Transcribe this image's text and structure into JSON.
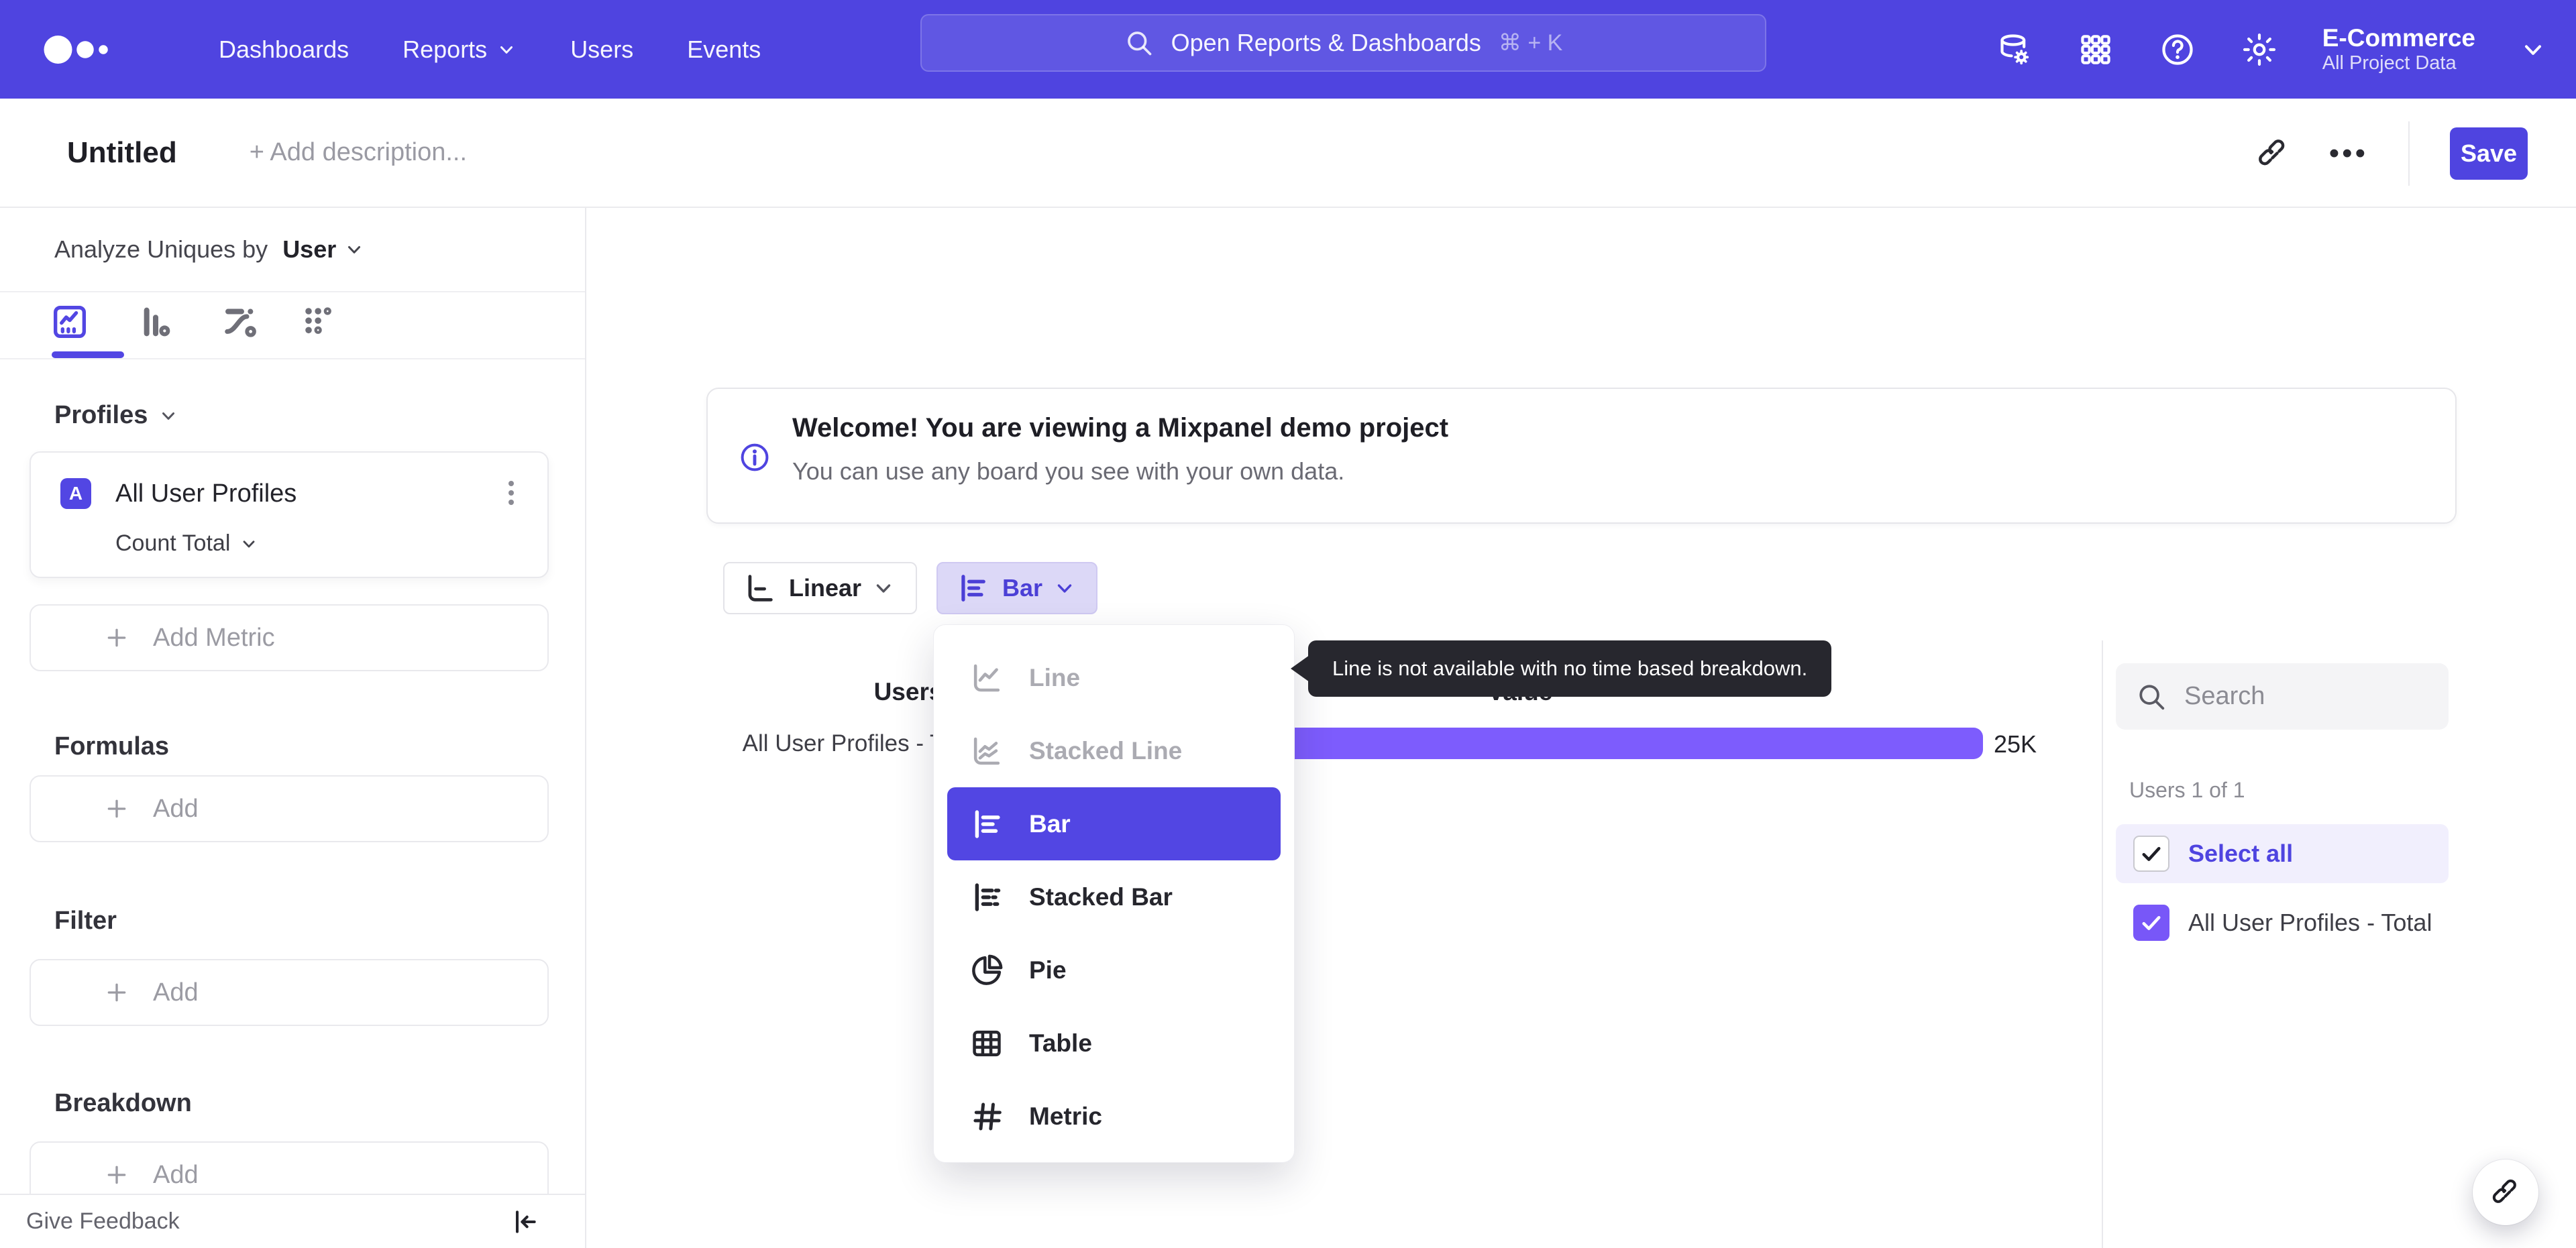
{
  "colors": {
    "brand_indigo": "#4f44e0",
    "menu_selected_bg": "#5246e3",
    "bar_fill": "#7d5cfd",
    "checkbox_fill": "#7857f8",
    "chip_bg": "#dcd8f7",
    "select_all_bg": "#f1effd",
    "tooltip_bg": "#27272e"
  },
  "topnav": {
    "items": [
      {
        "label": "Dashboards"
      },
      {
        "label": "Reports"
      },
      {
        "label": "Users"
      },
      {
        "label": "Events"
      }
    ],
    "search": {
      "placeholder": "Open Reports & Dashboards",
      "shortcut": "⌘ + K"
    },
    "project": {
      "name": "E-Commerce",
      "scope": "All Project Data"
    }
  },
  "header": {
    "title": "Untitled",
    "description_placeholder": "+ Add description...",
    "save_label": "Save"
  },
  "sidebar": {
    "analyze_label": "Analyze Uniques by",
    "analyze_value": "User",
    "profiles_label": "Profiles",
    "metric_card": {
      "badge": "A",
      "name": "All User Profiles",
      "aggregation": "Count Total"
    },
    "add_metric_label": "Add Metric",
    "sections": [
      {
        "title": "Formulas",
        "add_label": "Add"
      },
      {
        "title": "Filter",
        "add_label": "Add"
      },
      {
        "title": "Breakdown",
        "add_label": "Add"
      }
    ],
    "feedback_label": "Give Feedback"
  },
  "banner": {
    "title": "Welcome! You are viewing a Mixpanel demo project",
    "subtitle": "You can use any board you see with your own data."
  },
  "controls": {
    "scale_label": "Linear",
    "chart_type_label": "Bar"
  },
  "chart_menu": {
    "items": [
      {
        "label": "Line",
        "state": "disabled"
      },
      {
        "label": "Stacked Line",
        "state": "disabled"
      },
      {
        "label": "Bar",
        "state": "selected"
      },
      {
        "label": "Stacked Bar",
        "state": "normal"
      },
      {
        "label": "Pie",
        "state": "normal"
      },
      {
        "label": "Table",
        "state": "normal"
      },
      {
        "label": "Metric",
        "state": "normal"
      }
    ]
  },
  "tooltip": {
    "text": "Line is not available with no time based breakdown."
  },
  "chart_data": {
    "type": "bar",
    "orientation": "horizontal",
    "title": "",
    "columns": [
      "Users",
      "Value"
    ],
    "categories": [
      "All User Profiles - Total"
    ],
    "values": [
      25000
    ],
    "value_labels": [
      "25K"
    ],
    "bar_color": "#7d5cfd",
    "grid": false,
    "legend": false
  },
  "right_panel": {
    "search_placeholder": "Search",
    "count_label": "Users 1 of 1",
    "select_all_label": "Select all",
    "items": [
      {
        "label": "All User Profiles - Total",
        "checked": true
      }
    ]
  }
}
